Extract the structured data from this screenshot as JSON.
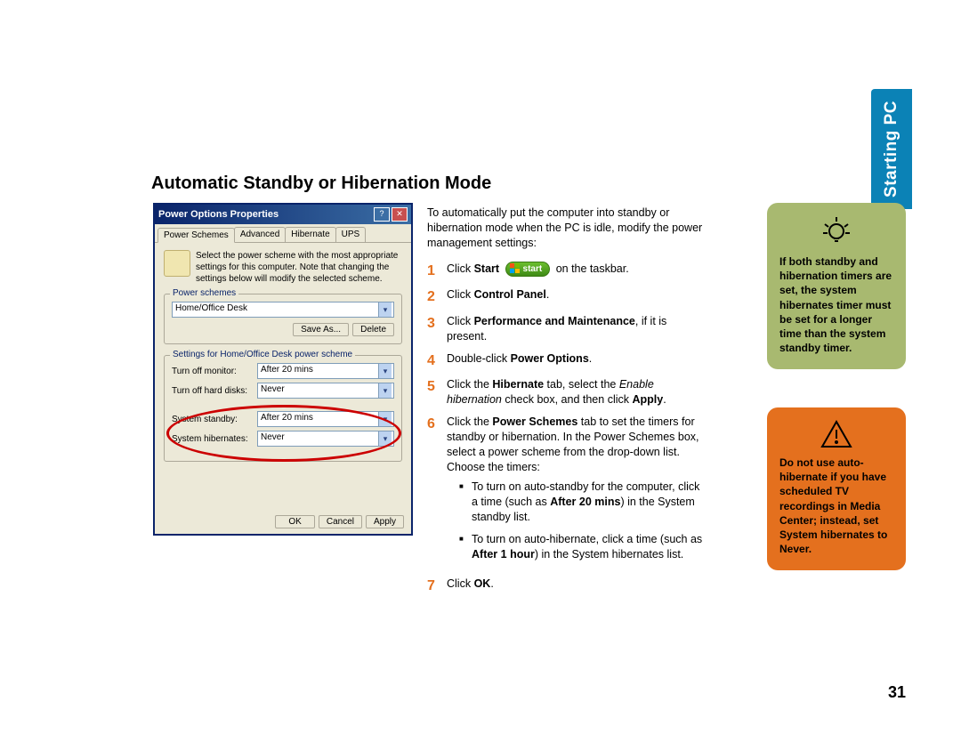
{
  "page": {
    "heading": "Automatic Standby or Hibernation Mode",
    "page_number": "31",
    "side_tab": "Starting PC"
  },
  "dialog": {
    "title": "Power Options Properties",
    "help_btn": "?",
    "close_btn": "✕",
    "tabs": {
      "power_schemes": "Power Schemes",
      "advanced": "Advanced",
      "hibernate": "Hibernate",
      "ups": "UPS"
    },
    "description": "Select the power scheme with the most appropriate settings for this computer. Note that changing the settings below will modify the selected scheme.",
    "group_power_schemes": "Power schemes",
    "scheme_value": "Home/Office Desk",
    "btn_save_as": "Save As...",
    "btn_delete": "Delete",
    "group_settings_label": "Settings for Home/Office Desk power scheme",
    "settings": {
      "monitor_label": "Turn off monitor:",
      "monitor_value": "After 20 mins",
      "disks_label": "Turn off hard disks:",
      "disks_value": "Never",
      "standby_label": "System standby:",
      "standby_value": "After 20 mins",
      "hibernate_label": "System hibernates:",
      "hibernate_value": "Never"
    },
    "footer": {
      "ok": "OK",
      "cancel": "Cancel",
      "apply": "Apply"
    }
  },
  "steps": {
    "intro": "To automatically put the computer into standby or hibernation mode when the PC is idle, modify the power management settings:",
    "s1_pre": "Click ",
    "s1_bold": "Start",
    "s1_start_label": "start",
    "s1_post": " on the taskbar.",
    "s2_pre": "Click ",
    "s2_bold": "Control Panel",
    "s2_post": ".",
    "s3_pre": "Click ",
    "s3_bold": "Performance and Maintenance",
    "s3_post": ", if it is present.",
    "s4_pre": "Double-click ",
    "s4_bold": "Power Options",
    "s4_post": ".",
    "s5_pre": "Click the ",
    "s5_bold1": "Hibernate",
    "s5_mid": " tab, select the ",
    "s5_italic": "Enable hibernation",
    "s5_mid2": " check box, and then click ",
    "s5_bold2": "Apply",
    "s5_post": ".",
    "s6_pre": "Click the ",
    "s6_bold": "Power Schemes",
    "s6_post": " tab to set the timers for standby or hibernation. In the Power Schemes box, select a power scheme from the drop-down list. Choose the timers:",
    "s6_b1_pre": "To turn on auto-standby for the computer, click a time (such as ",
    "s6_b1_bold": "After 20 mins",
    "s6_b1_post": ") in the System standby list.",
    "s6_b2_pre": "To turn on auto-hibernate, click a time (such as ",
    "s6_b2_bold": "After 1 hour",
    "s6_b2_post": ") in the System hibernates list.",
    "s7_pre": "Click ",
    "s7_bold": "OK",
    "s7_post": "."
  },
  "callouts": {
    "tip": "If both standby and hibernation timers are set, the system hibernates timer must be set for a longer time than the system standby timer.",
    "warning": "Do not use auto-hibernate if you have scheduled TV recordings in Media Center; instead, set System hibernates to Never."
  }
}
